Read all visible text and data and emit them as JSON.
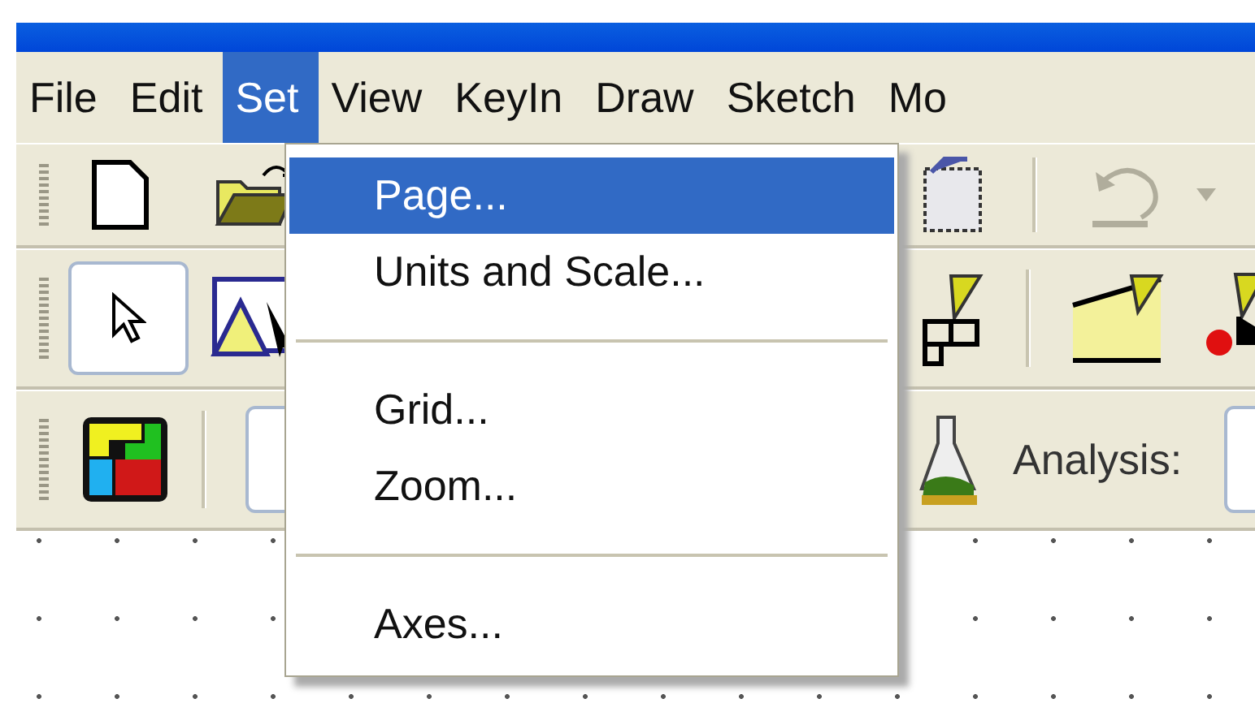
{
  "menu_bar": [
    {
      "label": "File",
      "selected": false
    },
    {
      "label": "Edit",
      "selected": false
    },
    {
      "label": "Set",
      "selected": true
    },
    {
      "label": "View",
      "selected": false
    },
    {
      "label": "KeyIn",
      "selected": false
    },
    {
      "label": "Draw",
      "selected": false
    },
    {
      "label": "Sketch",
      "selected": false
    },
    {
      "label": "Mo",
      "selected": false
    }
  ],
  "set_menu": [
    {
      "kind": "item",
      "label": "Page...",
      "selected": true
    },
    {
      "kind": "item",
      "label": "Units and Scale...",
      "selected": false
    },
    {
      "kind": "separator"
    },
    {
      "kind": "item",
      "label": "Grid...",
      "selected": false
    },
    {
      "kind": "item",
      "label": "Zoom...",
      "selected": false
    },
    {
      "kind": "separator"
    },
    {
      "kind": "item",
      "label": "Axes...",
      "selected": false
    }
  ],
  "select_tool": {
    "selected": true
  },
  "analysis_toolbar": {
    "label": "Analysis:"
  }
}
